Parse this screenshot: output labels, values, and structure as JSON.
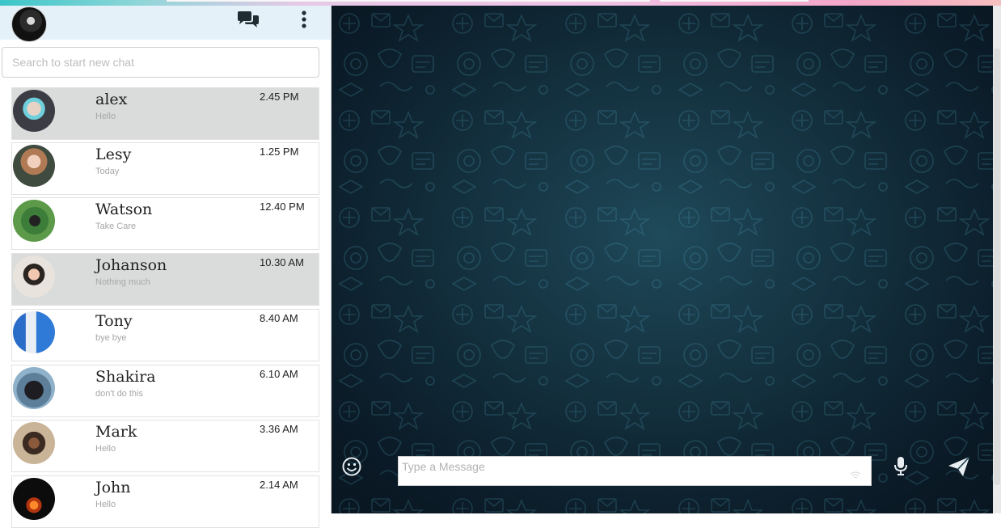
{
  "colors": {
    "header_bg": "#e4f1f9",
    "selected_row": "#d9dcdb",
    "chat_bg": "#17394a",
    "pattern": "#2d6479"
  },
  "header": {
    "chat_icon": "chat-bubbles-icon",
    "menu_icon": "vertical-dots-icon"
  },
  "search": {
    "placeholder": "Search to start new chat"
  },
  "contacts": [
    {
      "name": "alex",
      "last_message": "Hello",
      "time": "2.45 PM",
      "selected": true
    },
    {
      "name": "Lesy",
      "last_message": "Today",
      "time": "1.25 PM",
      "selected": false
    },
    {
      "name": "Watson",
      "last_message": "Take Care",
      "time": "12.40 PM",
      "selected": false
    },
    {
      "name": "Johanson",
      "last_message": "Nothing much",
      "time": "10.30 AM",
      "selected": true
    },
    {
      "name": "Tony",
      "last_message": "bye bye",
      "time": "8.40 AM",
      "selected": false
    },
    {
      "name": "Shakira",
      "last_message": "don't do this",
      "time": "6.10 AM",
      "selected": false
    },
    {
      "name": "Mark",
      "last_message": "Hello",
      "time": "3.36 AM",
      "selected": false
    },
    {
      "name": "John",
      "last_message": "Hello",
      "time": "2.14 AM",
      "selected": false
    }
  ],
  "composer": {
    "placeholder": "Type a Message",
    "emoji_icon": "smiley-icon",
    "mic_icon": "microphone-icon",
    "send_icon": "paper-plane-icon"
  }
}
